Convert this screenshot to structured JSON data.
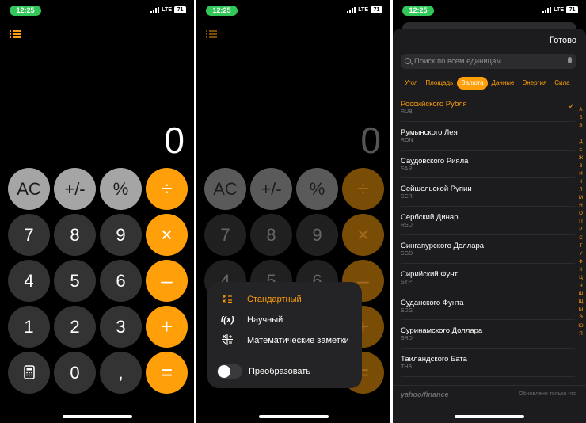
{
  "status": {
    "time": "12:25",
    "network": "LTE",
    "battery": "71"
  },
  "calculator": {
    "display": "0",
    "keys": {
      "ac": "AC",
      "plus_minus": "+/-",
      "percent": "%",
      "divide": "÷",
      "seven": "7",
      "eight": "8",
      "nine": "9",
      "multiply": "×",
      "four": "4",
      "five": "5",
      "six": "6",
      "minus": "–",
      "one": "1",
      "two": "2",
      "three": "3",
      "plus": "+",
      "zero": "0",
      "comma": ",",
      "equals": "="
    }
  },
  "menu": {
    "items": [
      {
        "icon": "standard-calc-icon",
        "label": "Стандартный"
      },
      {
        "icon": "scientific-fx-icon",
        "label": "Научный"
      },
      {
        "icon": "math-notes-icon",
        "label": "Математические заметки"
      }
    ],
    "convert_label": "Преобразовать",
    "fx_glyph": "f(x)"
  },
  "converter": {
    "done_label": "Готово",
    "search_placeholder": "Поиск по всем единицам",
    "categories": [
      "Угол",
      "Площадь",
      "Валюта",
      "Данные",
      "Энергия",
      "Сила"
    ],
    "selected_category": "Валюта",
    "currencies": [
      {
        "name": "Российского Рубля",
        "code": "RUB",
        "selected": true
      },
      {
        "name": "Румынского Лея",
        "code": "RON"
      },
      {
        "name": "Саудовского Рияла",
        "code": "SAR"
      },
      {
        "name": "Сейшельской Рупии",
        "code": "SCR"
      },
      {
        "name": "Сербский Динар",
        "code": "RSD"
      },
      {
        "name": "Сингапурского Доллара",
        "code": "SGD"
      },
      {
        "name": "Сирийский Фунт",
        "code": "SYP"
      },
      {
        "name": "Суданского Фунта",
        "code": "SDG"
      },
      {
        "name": "Суринамского Доллара",
        "code": "SRD"
      },
      {
        "name": "Таиландского Бата",
        "code": "THB"
      }
    ],
    "checkmark": "✓",
    "alphabet": [
      "А",
      "Б",
      "В",
      "Г",
      "Д",
      "Е",
      "Ж",
      "З",
      "И",
      "К",
      "Л",
      "М",
      "Н",
      "О",
      "П",
      "Р",
      "С",
      "Т",
      "У",
      "Ф",
      "Х",
      "Ц",
      "Ч",
      "Ш",
      "Щ",
      "Ы",
      "Э",
      "Ю",
      "Я"
    ],
    "source": "yahoo/finance",
    "updated_label": "Обновлено только что"
  },
  "colors": {
    "accent": "#ff9f0a",
    "status_green": "#31c759",
    "key_dark": "#333333",
    "key_light": "#a5a5a5"
  }
}
